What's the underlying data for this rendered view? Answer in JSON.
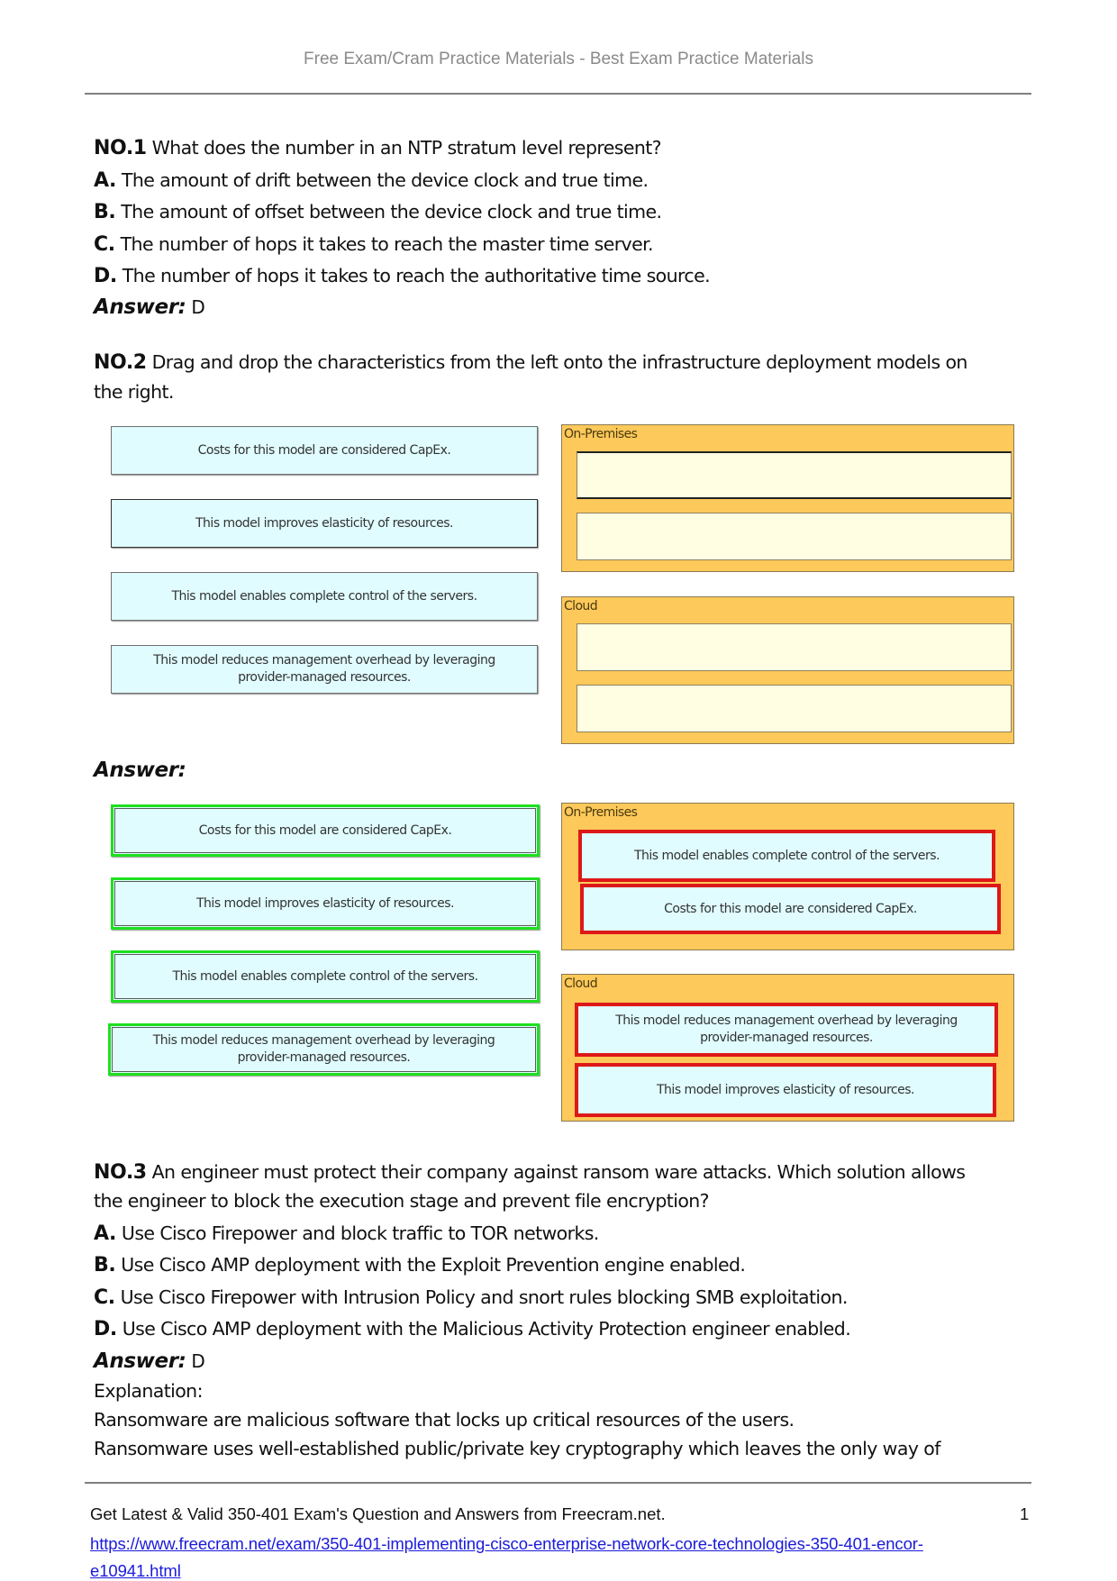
{
  "header": {
    "title": "Free Exam/Cram Practice Materials - Best Exam Practice Materials"
  },
  "questions": [
    {
      "number": "NO.1",
      "text": "What does the number in an NTP stratum level represent?",
      "options": [
        {
          "letter": "A.",
          "text": "The amount of drift between the device clock and true time."
        },
        {
          "letter": "B.",
          "text": "The amount of offset between the device clock and true time."
        },
        {
          "letter": "C.",
          "text": "The number of hops it takes to reach the master time server."
        },
        {
          "letter": "D.",
          "text": "The number of hops it takes to reach the authoritative time source."
        }
      ],
      "answer_label": "Answer:",
      "answer": "D"
    },
    {
      "number": "NO.2",
      "text_line1": "Drag and drop the characteristics from the left onto the infrastructure deployment models on",
      "text_line2": "the right.",
      "answer_label": "Answer:",
      "colors": {
        "source_bg": "#e0fcff",
        "panel_bg": "#fdc95a",
        "slot_bg": "#fffee2",
        "correct_border": "#1ee01e",
        "placed_border": "#dd1818"
      },
      "question_figure": {
        "sources": [
          "Costs for this model are considered CapEx.",
          "This model improves elasticity of resources.",
          "This model enables complete control of the servers.",
          "This model reduces management overhead by leveraging provider-managed resources."
        ],
        "targets": [
          {
            "label": "On-Premises",
            "slots": [
              "",
              ""
            ]
          },
          {
            "label": "Cloud",
            "slots": [
              "",
              ""
            ]
          }
        ]
      },
      "answer_figure": {
        "sources": [
          "Costs for this model are considered CapEx.",
          "This model improves elasticity of resources.",
          "This model enables complete control of the servers.",
          "This model reduces management overhead by leveraging provider-managed resources."
        ],
        "targets": [
          {
            "label": "On-Premises",
            "slots": [
              "This model enables complete control of the servers.",
              "Costs for this model are considered CapEx."
            ]
          },
          {
            "label": "Cloud",
            "slots": [
              "This model reduces management overhead by leveraging provider-managed resources.",
              "This model improves elasticity of resources."
            ]
          }
        ]
      }
    },
    {
      "number": "NO.3",
      "text_line1": "An engineer must protect their company against ransom ware attacks. Which solution allows",
      "text_line2": "the engineer to block the execution stage and prevent file encryption?",
      "options": [
        {
          "letter": "A.",
          "text": "Use Cisco Firepower and block traffic to TOR networks."
        },
        {
          "letter": "B.",
          "text": "Use Cisco AMP deployment with the Exploit Prevention engine enabled."
        },
        {
          "letter": "C.",
          "text": "Use Cisco Firepower with Intrusion Policy and snort rules blocking SMB exploitation."
        },
        {
          "letter": "D.",
          "text": "Use Cisco AMP deployment with the Malicious Activity Protection engineer enabled."
        }
      ],
      "answer_label": "Answer:",
      "answer": "D",
      "explanation_label": "Explanation:",
      "explanation_lines": [
        "Ransomware are malicious software that locks up critical resources of the users.",
        "Ransomware uses well-established public/private key cryptography which leaves the only way of"
      ]
    }
  ],
  "footer": {
    "text": "Get Latest & Valid 350-401 Exam's Question and Answers from Freecram.net.",
    "page_number": "1",
    "link_line1": "https://www.freecram.net/exam/350-401-implementing-cisco-enterprise-network-core-technologies-350-401-encor-",
    "link_line2": "e10941.html"
  }
}
